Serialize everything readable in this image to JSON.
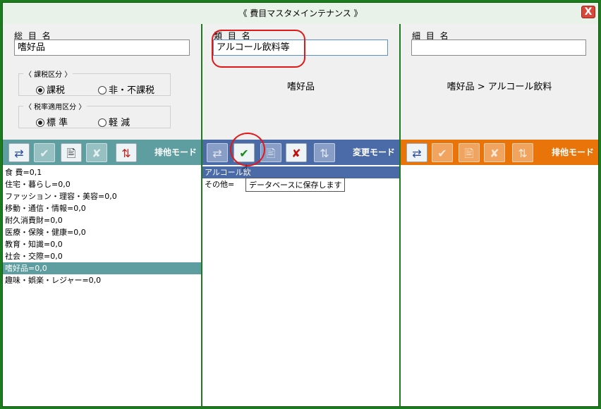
{
  "window": {
    "title": "《 費目マスタメインテナンス 》",
    "close_label": "X"
  },
  "left": {
    "label": "総 目 名",
    "value": "嗜好品",
    "tax_group": {
      "title": "〈 課税区分 〉",
      "options": [
        "課税",
        "非・不課税"
      ],
      "selected": 0
    },
    "rate_group": {
      "title": "〈 税率適用区分 〉",
      "options": [
        "標 準",
        "軽 減"
      ],
      "selected": 0
    },
    "mode": "排他モード",
    "items": [
      "食 費=0,1",
      "住宅・暮らし=0,0",
      "ファッション・理容・美容=0,0",
      "移動・通信・情報=0,0",
      "耐久消費財=0,0",
      "医療・保険・健康=0,0",
      "教育・知識=0,0",
      "社会・交際=0,0",
      "嗜好品=0,0",
      "趣味・娯楽・レジャー=0,0"
    ],
    "selected_index": 8
  },
  "middle": {
    "label": "類 目 名",
    "value": "アルコール飲料等",
    "crumb": "嗜好品",
    "mode": "変更モード",
    "items": [
      "アルコール飲",
      "その他="
    ],
    "selected_index": 0,
    "tooltip": "データベースに保存します"
  },
  "right": {
    "label": "細 目 名",
    "value": "",
    "crumb": "嗜好品 > アルコール飲料",
    "mode": "排他モード"
  },
  "icons": {
    "add": "⇄",
    "save": "✔",
    "edit": "🖹",
    "cancel": "✘",
    "sort": "⇅"
  },
  "colors": {
    "green": "#1e7a1e",
    "teal": "#5f9ea0",
    "blue": "#4a6aa8",
    "orange": "#e8740a",
    "red": "#e01818"
  }
}
